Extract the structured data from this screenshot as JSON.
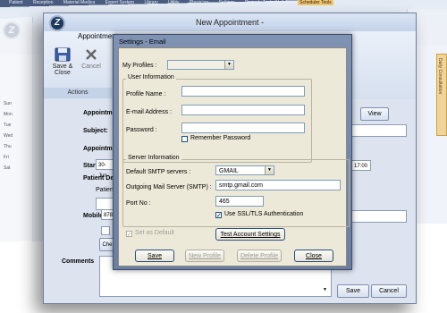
{
  "background_app": {
    "menu": [
      "Patient",
      "Reception",
      "Material Medica",
      "Expert System",
      "Library",
      "Utility",
      "Physician",
      "Settings",
      "Remedy Tools (Hello)",
      "Scheduler Tools",
      "Style"
    ],
    "left_tabs": [
      "Sun",
      "Mon",
      "Tue",
      "Wed",
      "Thu",
      "Fri",
      "Sat"
    ],
    "right_tab": "Daily Consultation",
    "logo_letter": "Z"
  },
  "appointment": {
    "title": "New Appointment -",
    "logo_letter": "Z",
    "ribbon_tab": "Appointment",
    "ribbon_group": "Actions",
    "save_close": [
      "Save &",
      "Close"
    ],
    "cancel": "Cancel",
    "fields": {
      "appointment_type": "Appointment Type",
      "subject": "Subject:",
      "appointment_date": "Appointment Date",
      "start_time": "Start Time:",
      "start_date_value": "30-Jun",
      "time_value": "17:00",
      "patient_details": "Patient Details",
      "patient_id": "Patient ID",
      "mobile": "Mobile:",
      "mobile_value": "878",
      "comments": "Comments"
    },
    "view_button": "View",
    "save_button": "Save",
    "cancel_button": "Cancel"
  },
  "email_settings": {
    "title": "Settings - Email",
    "my_profiles_label": "My Profiles :",
    "my_profiles_value": "",
    "user_info": {
      "title": "User Information",
      "profile_name_label": "Profile Name :",
      "profile_name_value": "",
      "email_label": "E-mail Address :",
      "email_value": "",
      "password_label": "Password :",
      "password_value": "",
      "remember_password": "Remember Password",
      "remember_checked": false
    },
    "server_info": {
      "title": "Server Information",
      "smtp_servers_label": "Default SMTP servers :",
      "smtp_servers_value": "GMAIL",
      "outgoing_label": "Outgoing Mail Server (SMTP) :",
      "outgoing_value": "smtp.gmail.com",
      "port_label": "Port No :",
      "port_value": "465",
      "ssl_label": "Use SSL/TLS Authentication",
      "ssl_checked": true
    },
    "set_default_label": "Set as Default",
    "set_default_checked": true,
    "test_button": "Test Account Settings",
    "save_button": "Save",
    "new_profile_button": "New Profile",
    "delete_profile_button": "Delete Profile",
    "close_button": "Close"
  },
  "colors": {
    "dialog_frame": "#6f83a7",
    "dialog_client": "#ece9d8",
    "appointment_frame": "#dfe6f1"
  }
}
